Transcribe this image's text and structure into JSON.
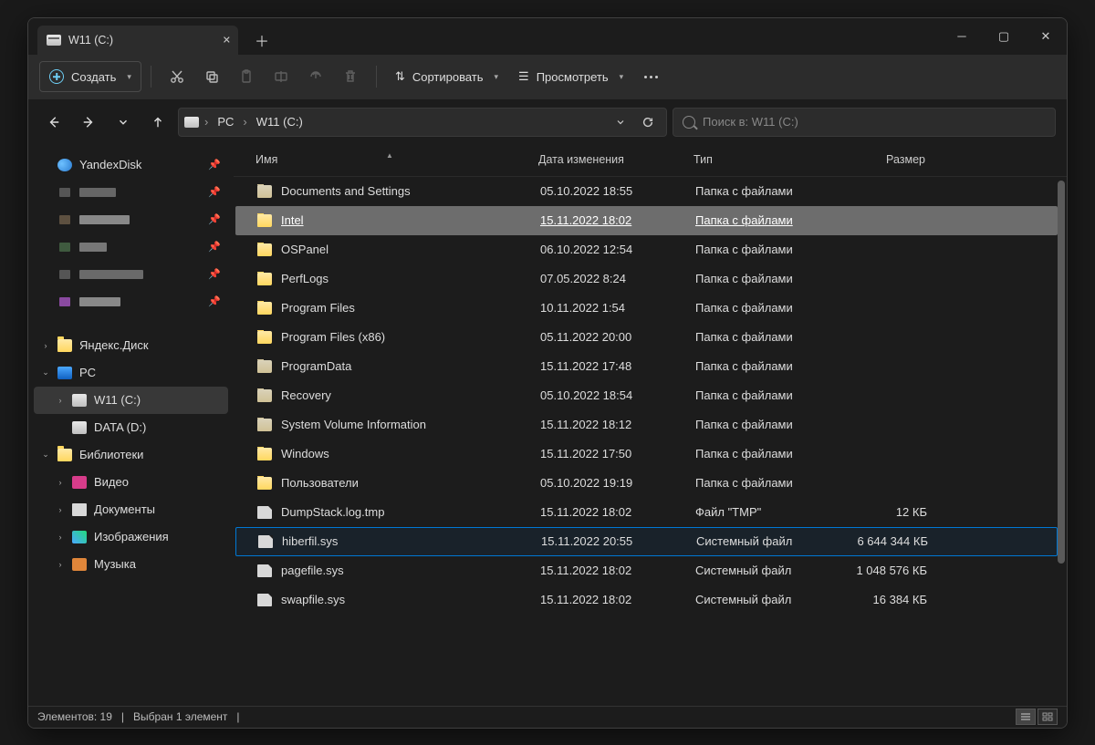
{
  "titlebar": {
    "tab_title": "W11 (C:)"
  },
  "toolbar": {
    "create": "Создать",
    "sort": "Сортировать",
    "view": "Просмотреть"
  },
  "breadcrumb": {
    "pc": "PC",
    "drive": "W11 (C:)"
  },
  "search": {
    "placeholder": "Поиск в: W11 (C:)"
  },
  "sidebar": {
    "yandexdisk": "YandexDisk",
    "yandexdisk_ru": "Яндекс.Диск",
    "pc": "PC",
    "w11": "W11 (C:)",
    "data": "DATA (D:)",
    "libraries": "Библиотеки",
    "video": "Видео",
    "documents": "Документы",
    "images": "Изображения",
    "music": "Музыка"
  },
  "columns": {
    "name": "Имя",
    "date": "Дата изменения",
    "type": "Тип",
    "size": "Размер"
  },
  "rows": [
    {
      "icon": "folder-dim",
      "name": "Documents and Settings",
      "date": "05.10.2022 18:55",
      "type": "Папка с файлами",
      "size": ""
    },
    {
      "icon": "folder",
      "name": "Intel",
      "date": "15.11.2022 18:02",
      "type": "Папка с файлами",
      "size": "",
      "hl": true
    },
    {
      "icon": "folder",
      "name": "OSPanel",
      "date": "06.10.2022 12:54",
      "type": "Папка с файлами",
      "size": ""
    },
    {
      "icon": "folder",
      "name": "PerfLogs",
      "date": "07.05.2022 8:24",
      "type": "Папка с файлами",
      "size": ""
    },
    {
      "icon": "folder",
      "name": "Program Files",
      "date": "10.11.2022 1:54",
      "type": "Папка с файлами",
      "size": ""
    },
    {
      "icon": "folder",
      "name": "Program Files (x86)",
      "date": "05.11.2022 20:00",
      "type": "Папка с файлами",
      "size": ""
    },
    {
      "icon": "folder-dim",
      "name": "ProgramData",
      "date": "15.11.2022 17:48",
      "type": "Папка с файлами",
      "size": ""
    },
    {
      "icon": "folder-dim",
      "name": "Recovery",
      "date": "05.10.2022 18:54",
      "type": "Папка с файлами",
      "size": ""
    },
    {
      "icon": "folder-dim",
      "name": "System Volume Information",
      "date": "15.11.2022 18:12",
      "type": "Папка с файлами",
      "size": ""
    },
    {
      "icon": "folder",
      "name": "Windows",
      "date": "15.11.2022 17:50",
      "type": "Папка с файлами",
      "size": ""
    },
    {
      "icon": "folder",
      "name": "Пользователи",
      "date": "05.10.2022 19:19",
      "type": "Папка с файлами",
      "size": ""
    },
    {
      "icon": "file",
      "name": "DumpStack.log.tmp",
      "date": "15.11.2022 18:02",
      "type": "Файл \"TMP\"",
      "size": "12 КБ"
    },
    {
      "icon": "file",
      "name": "hiberfil.sys",
      "date": "15.11.2022 20:55",
      "type": "Системный файл",
      "size": "6 644 344 КБ",
      "sel": true
    },
    {
      "icon": "file",
      "name": "pagefile.sys",
      "date": "15.11.2022 18:02",
      "type": "Системный файл",
      "size": "1 048 576 КБ"
    },
    {
      "icon": "file",
      "name": "swapfile.sys",
      "date": "15.11.2022 18:02",
      "type": "Системный файл",
      "size": "16 384 КБ"
    }
  ],
  "status": {
    "items": "Элементов: 19",
    "selected": "Выбран 1 элемент"
  }
}
